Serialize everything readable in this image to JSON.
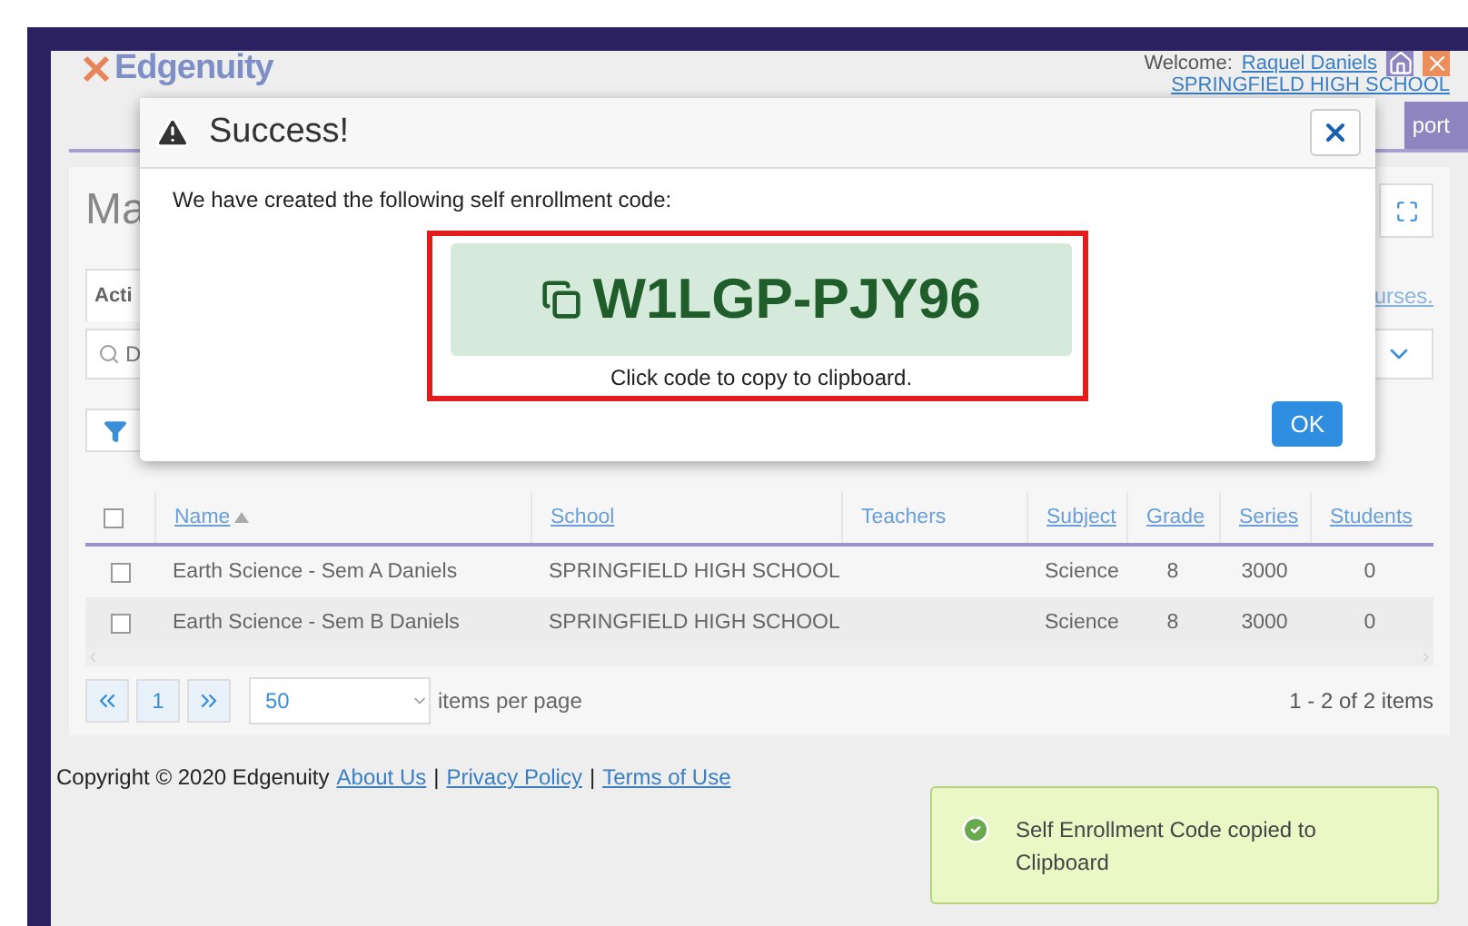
{
  "header": {
    "logo": "Edgenuity",
    "welcome_label": "Welcome:",
    "user": "Raquel Daniels",
    "school": "SPRINGFIELD HIGH SCHOOL",
    "nav_button": "port"
  },
  "page": {
    "title": "Ma",
    "tab": {
      "label": "Acti",
      "selected": true
    },
    "link": "urses.",
    "search": {
      "value": "D"
    }
  },
  "table": {
    "select_all": {
      "checked": false
    },
    "columns": [
      {
        "label": "Name",
        "link": true,
        "sorted": true
      },
      {
        "label": "School",
        "link": true,
        "sorted": false
      },
      {
        "label": "Teachers",
        "link": false,
        "sorted": false
      },
      {
        "label": "Subject",
        "link": true,
        "sorted": false
      },
      {
        "label": "Grade",
        "link": true,
        "sorted": false
      },
      {
        "label": "Series",
        "link": true,
        "sorted": false
      },
      {
        "label": "Students",
        "link": true,
        "sorted": false
      }
    ],
    "rows": [
      {
        "checked": false,
        "cells": [
          "Earth Science - Sem A Daniels",
          "SPRINGFIELD HIGH SCHOOL",
          "",
          "Science",
          "8",
          "3000",
          "0"
        ]
      },
      {
        "checked": false,
        "cells": [
          "Earth Science - Sem B Daniels",
          "SPRINGFIELD HIGH SCHOOL",
          "",
          "Science",
          "8",
          "3000",
          "0"
        ]
      }
    ]
  },
  "pagination": {
    "page": "1",
    "page_size": "50",
    "label": "items per page",
    "summary": "1 - 2 of 2 items"
  },
  "footer": {
    "copyright": "Copyright © 2020 Edgenuity",
    "links": [
      "About Us",
      "Privacy Policy",
      "Terms of Use"
    ],
    "separator": "|"
  },
  "modal": {
    "title": "Success!",
    "message": "We have created the following self enrollment code:",
    "code": "W1LGP-PJY96",
    "hint": "Click code to copy to clipboard.",
    "ok": "OK"
  },
  "toast": {
    "message": "Self Enrollment Code copied to Clipboard"
  }
}
